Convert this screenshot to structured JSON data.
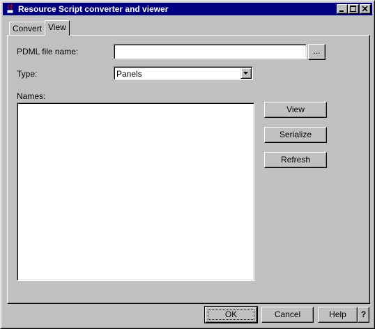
{
  "window": {
    "title": "Resource Script converter and viewer",
    "icon": "java-app-icon",
    "controls": [
      "minimize-icon",
      "maximize-icon",
      "close-icon"
    ]
  },
  "tabs": [
    {
      "label": "Convert",
      "active": false
    },
    {
      "label": "View",
      "active": true
    }
  ],
  "form": {
    "pdml_label": "PDML file name:",
    "pdml_value": "",
    "browse_label": "...",
    "type_label": "Type:",
    "type_value": "Panels",
    "names_label": "Names:",
    "names_items": []
  },
  "actions": {
    "view": "View",
    "serialize": "Serialize",
    "refresh": "Refresh"
  },
  "footer": {
    "ok": "OK",
    "cancel": "Cancel",
    "help": "Help",
    "whats_this": "?"
  }
}
